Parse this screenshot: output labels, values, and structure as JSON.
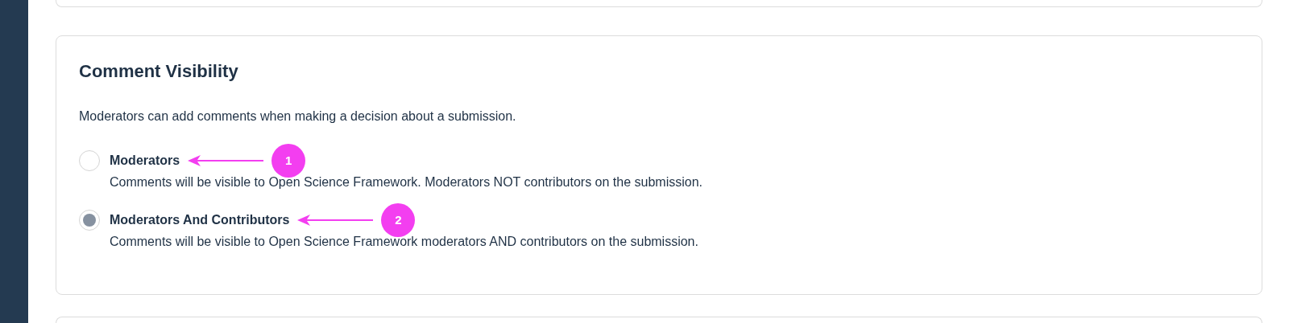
{
  "section": {
    "title": "Comment Visibility",
    "description": "Moderators can add comments when making a decision about a submission.",
    "options": [
      {
        "label": "Moderators",
        "description": "Comments will be visible to Open Science Framework. Moderators NOT contributors on the submission.",
        "selected": false,
        "annotation": "1"
      },
      {
        "label": "Moderators And Contributors",
        "description": "Comments will be visible to Open Science Framework moderators AND contributors on the submission.",
        "selected": true,
        "annotation": "2"
      }
    ]
  }
}
